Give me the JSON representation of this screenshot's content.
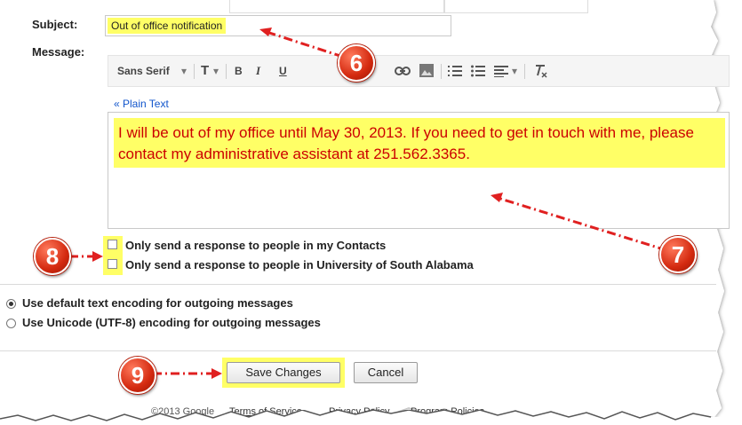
{
  "form": {
    "subject_label": "Subject:",
    "subject_value": "Out of office notification",
    "message_label": "Message:"
  },
  "toolbar": {
    "font": "Sans Serif",
    "font_dropdown": "▾",
    "size": "T",
    "size_dropdown": "▾",
    "bold": "B",
    "italic": "I",
    "underline": "U",
    "align_dropdown": "▾",
    "icons": [
      "font-size-icon",
      "bold-icon",
      "italic-icon",
      "underline-icon",
      "text-color-icon",
      "link-icon",
      "image-icon",
      "numbered-list-icon",
      "bulleted-list-icon",
      "align-icon",
      "remove-formatting-icon"
    ]
  },
  "editor": {
    "plain_text_link": "« Plain Text",
    "body": "I will be out of my office until May 30, 2013.  If you need to get in touch with me, please contact my administrative assistant at 251.562.3365."
  },
  "options": {
    "contacts_only": "Only send a response to people in my Contacts",
    "domain_only": "Only send a response to people in University of South Alabama"
  },
  "encoding": {
    "default": "Use default text encoding for outgoing messages",
    "unicode": "Use Unicode (UTF-8) encoding for outgoing messages",
    "selected": "default"
  },
  "buttons": {
    "save": "Save Changes",
    "cancel": "Cancel"
  },
  "footer": {
    "copyright": "©2013 Google",
    "terms": "Terms of Service",
    "privacy": "Privacy Policy",
    "policies": "Program Policies"
  },
  "callouts": [
    "6",
    "7",
    "8",
    "9"
  ],
  "colors": {
    "highlight": "#ffff66",
    "callout": "#d42a10",
    "arrow": "#e02020",
    "message_text": "#cc0000",
    "link": "#1155cc"
  }
}
